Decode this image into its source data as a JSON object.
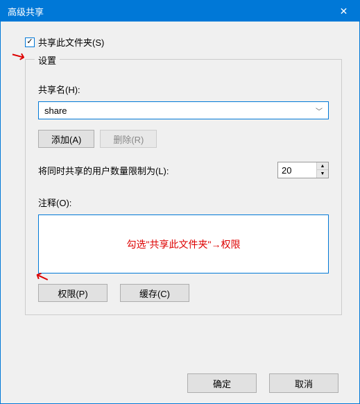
{
  "titlebar": {
    "title": "高级共享",
    "close_icon": "✕"
  },
  "share_checkbox": {
    "label": "共享此文件夹(S)",
    "checked": true
  },
  "settings": {
    "legend": "设置",
    "share_name_label": "共享名(H):",
    "share_name_value": "share",
    "add_btn": "添加(A)",
    "remove_btn": "删除(R)",
    "limit_label": "将同时共享的用户数量限制为(L):",
    "limit_value": "20",
    "comment_label": "注释(O):",
    "annotation_text": "勾选\"共享此文件夹\"→权限",
    "permissions_btn": "权限(P)",
    "cache_btn": "缓存(C)"
  },
  "footer": {
    "ok_btn": "确定",
    "cancel_btn": "取消"
  }
}
